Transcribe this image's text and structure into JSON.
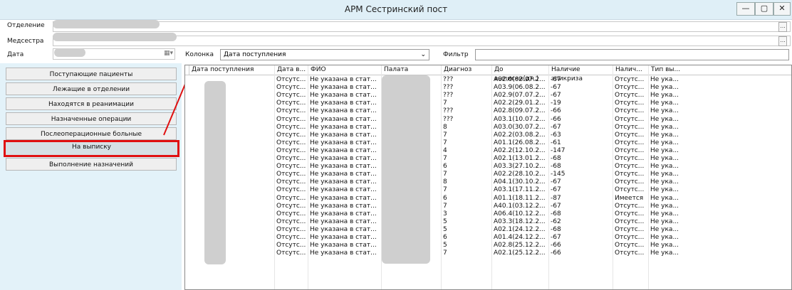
{
  "window": {
    "title": "АРМ Сестринский пост",
    "min": "—",
    "max": "▢",
    "close": "✕"
  },
  "form": {
    "dept_label": "Отделение",
    "nurse_label": "Медсестра",
    "date_label": "Дата",
    "browse": "..."
  },
  "nav": {
    "items": [
      "Поступающие пациенты",
      "Лежащие в отделении",
      "Находятся в реанимации",
      "Назначенные операции",
      "Послеоперационные больные",
      "На выписку",
      "Выполнение назначений"
    ],
    "active_index": 5
  },
  "toolbar": {
    "column_label": "Колонка",
    "column_value": "Дата поступления",
    "filter_label": "Фильтр",
    "filter_value": ""
  },
  "table": {
    "headers": [
      "Дата поступления",
      "Дата в...",
      "ФИО",
      "Палата",
      "Диагноз",
      "До выписки(дн.)",
      "Наличие эпикриза",
      "Налич...",
      "Тип вы..."
    ],
    "rows": [
      [
        "Отсутс...",
        "Не указана в стат...",
        "???",
        "A02.0(02.07.2...",
        "-67",
        "Отсутс...",
        "Не ука..."
      ],
      [
        "Отсутс...",
        "Не указана в стат...",
        "???",
        "A03.9(06.08.2...",
        "-67",
        "Отсутс...",
        "Не ука..."
      ],
      [
        "Отсутс...",
        "Не указана в стат...",
        "???",
        "A02.9(07.07.2...",
        "-67",
        "Отсутс...",
        "Не ука..."
      ],
      [
        "Отсутс...",
        "Не указана в стат...",
        "7",
        "A02.2(29.01.2...",
        "-19",
        "Отсутс...",
        "Не ука..."
      ],
      [
        "Отсутс...",
        "Не указана в стат...",
        "???",
        "A02.8(09.07.2...",
        "-66",
        "Отсутс...",
        "Не ука..."
      ],
      [
        "Отсутс...",
        "Не указана в стат...",
        "???",
        "A03.1(10.07.2...",
        "-66",
        "Отсутс...",
        "Не ука..."
      ],
      [
        "Отсутс...",
        "Не указана в стат...",
        "8",
        "A03.0(30.07.2...",
        "-67",
        "Отсутс...",
        "Не ука..."
      ],
      [
        "Отсутс...",
        "Не указана в стат...",
        "7",
        "A02.2(03.08.2...",
        "-63",
        "Отсутс...",
        "Не ука..."
      ],
      [
        "Отсутс...",
        "Не указана в стат...",
        "7",
        "A01.1(26.08.2...",
        "-61",
        "Отсутс...",
        "Не ука..."
      ],
      [
        "Отсутс...",
        "Не указана в стат...",
        "4",
        "A02.2(12.10.2...",
        "-147",
        "Отсутс...",
        "Не ука..."
      ],
      [
        "Отсутс...",
        "Не указана в стат...",
        "7",
        "A02.1(13.01.2...",
        "-68",
        "Отсутс...",
        "Не ука..."
      ],
      [
        "Отсутс...",
        "Не указана в стат...",
        "6",
        "A03.3(27.10.2...",
        "-68",
        "Отсутс...",
        "Не ука..."
      ],
      [
        "Отсутс...",
        "Не указана в стат...",
        "7",
        "A02.2(28.10.2...",
        "-145",
        "Отсутс...",
        "Не ука..."
      ],
      [
        "Отсутс...",
        "Не указана в стат...",
        "8",
        "A04.1(30.10.2...",
        "-67",
        "Отсутс...",
        "Не ука..."
      ],
      [
        "Отсутс...",
        "Не указана в стат...",
        "7",
        "A03.1(17.11.2...",
        "-67",
        "Отсутс...",
        "Не ука..."
      ],
      [
        "Отсутс...",
        "Не указана в стат...",
        "6",
        "A01.1(18.11.2...",
        "-87",
        "Имеется",
        "Не ука..."
      ],
      [
        "Отсутс...",
        "Не указана в стат...",
        "7",
        "A40.1(03.12.2...",
        "-67",
        "Отсутс...",
        "Не ука..."
      ],
      [
        "Отсутс...",
        "Не указана в стат...",
        "3",
        "A06.4(10.12.2...",
        "-68",
        "Отсутс...",
        "Не ука..."
      ],
      [
        "Отсутс...",
        "Не указана в стат...",
        "5",
        "A03.3(18.12.2...",
        "-62",
        "Отсутс...",
        "Не ука..."
      ],
      [
        "Отсутс...",
        "Не указана в стат...",
        "5",
        "A02.1(24.12.2...",
        "-68",
        "Отсутс...",
        "Не ука..."
      ],
      [
        "Отсутс...",
        "Не указана в стат...",
        "6",
        "A01.4(24.12.2...",
        "-67",
        "Отсутс...",
        "Не ука..."
      ],
      [
        "Отсутс...",
        "Не указана в стат...",
        "5",
        "A02.8(25.12.2...",
        "-66",
        "Отсутс...",
        "Не ука..."
      ],
      [
        "Отсутс...",
        "Не указана в стат...",
        "7",
        "A02.1(25.12.2...",
        "-66",
        "Отсутс...",
        "Не ука..."
      ]
    ]
  },
  "colors": {
    "title_bg": "#dfeff7",
    "panel_bg": "#e3f2f9",
    "highlight": "#e01010"
  }
}
